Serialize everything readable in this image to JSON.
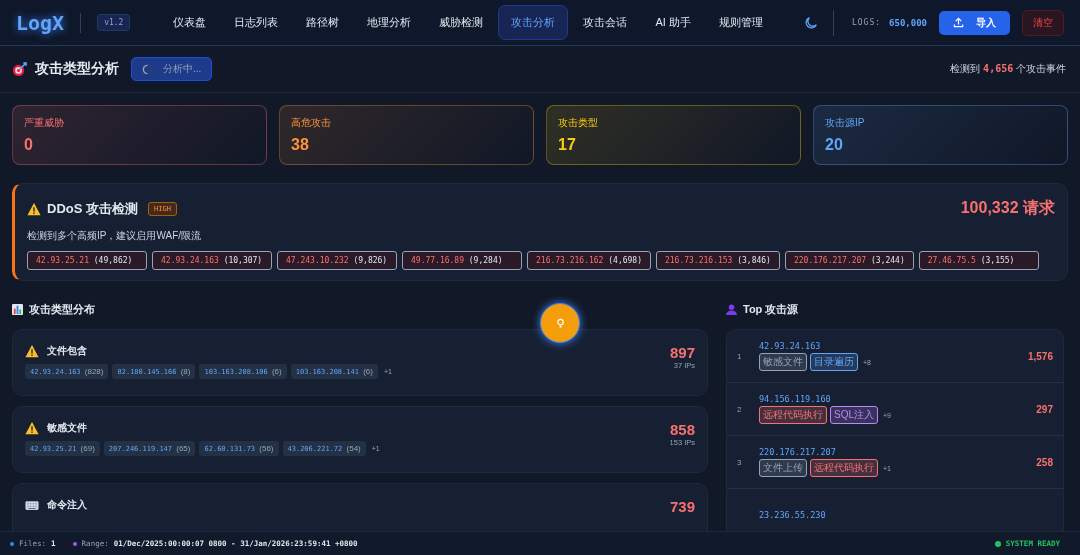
{
  "header": {
    "logo": "LogX",
    "version": "v1.2",
    "nav": [
      {
        "label": "仪表盘",
        "selected": false
      },
      {
        "label": "日志列表",
        "selected": false
      },
      {
        "label": "路径树",
        "selected": false
      },
      {
        "label": "地理分析",
        "selected": false
      },
      {
        "label": "威胁检测",
        "selected": false
      },
      {
        "label": "攻击分析",
        "selected": true
      },
      {
        "label": "攻击会话",
        "selected": false
      },
      {
        "label": "AI 助手",
        "selected": false
      },
      {
        "label": "规则管理",
        "selected": false
      }
    ],
    "logs_label": "LOGS:",
    "logs_value": "650,000",
    "import_button": "导入",
    "clear_button": "清空"
  },
  "page": {
    "title": "攻击类型分析",
    "status": "分析中...",
    "summary_prefix": "检测到",
    "summary_count": "4,656",
    "summary_suffix": "个攻击事件"
  },
  "stats": [
    {
      "label": "严重威胁",
      "value": "0",
      "color": "#f87171"
    },
    {
      "label": "高危攻击",
      "value": "38",
      "color": "#fb923c"
    },
    {
      "label": "攻击类型",
      "value": "17",
      "color": "#facc15"
    },
    {
      "label": "攻击源IP",
      "value": "20",
      "color": "#60a5fa"
    }
  ],
  "ddos": {
    "title": "DDoS 攻击检测",
    "badge": "HIGH",
    "requests": "100,332 请求",
    "advice": "检测到多个高频IP，建议启用WAF/限流",
    "ips": [
      {
        "ip": "42.93.25.21",
        "count": "(49,862)"
      },
      {
        "ip": "42.93.24.163",
        "count": "(10,307)"
      },
      {
        "ip": "47.243.10.232",
        "count": "(9,826)"
      },
      {
        "ip": "49.77.16.89",
        "count": "(9,284)"
      },
      {
        "ip": "216.73.216.162",
        "count": "(4,698)"
      },
      {
        "ip": "216.73.216.153",
        "count": "(3,846)"
      },
      {
        "ip": "220.176.217.207",
        "count": "(3,244)"
      },
      {
        "ip": "27.46.75.5",
        "count": "(3,155)"
      }
    ]
  },
  "distribution": {
    "title": "攻击类型分布",
    "items": [
      {
        "kind": "warning",
        "name": "文件包含",
        "total": "897",
        "ip_count": "37 IPs",
        "more": "+1",
        "ips": [
          {
            "ip": "42.93.24.163",
            "count": "(828)"
          },
          {
            "ip": "82.180.145.166",
            "count": "(8)"
          },
          {
            "ip": "103.163.208.106",
            "count": "(6)"
          },
          {
            "ip": "103.163.208.141",
            "count": "(6)"
          }
        ]
      },
      {
        "kind": "warning",
        "name": "敏感文件",
        "total": "858",
        "ip_count": "153 IPs",
        "more": "+1",
        "ips": [
          {
            "ip": "42.93.25.21",
            "count": "(69)"
          },
          {
            "ip": "207.246.119.147",
            "count": "(65)"
          },
          {
            "ip": "62.60.131.73",
            "count": "(56)"
          },
          {
            "ip": "43.206.221.72",
            "count": "(54)"
          }
        ]
      },
      {
        "kind": "keyboard",
        "name": "命令注入",
        "total": "739"
      }
    ]
  },
  "top_sources": {
    "title": "Top 攻击源",
    "rows": [
      {
        "rank": "1",
        "ip": "42.93.24.163",
        "total": "1,576",
        "more": "+8",
        "tags": [
          {
            "label": "敏感文件",
            "color": "#94a3b8"
          },
          {
            "label": "目录遍历",
            "color": "#60a5fa"
          }
        ]
      },
      {
        "rank": "2",
        "ip": "94.156.119.160",
        "total": "297",
        "more": "+9",
        "tags": [
          {
            "label": "远程代码执行",
            "color": "#f87171"
          },
          {
            "label": "SQL注入",
            "color": "#c084fc"
          }
        ]
      },
      {
        "rank": "3",
        "ip": "220.176.217.207",
        "total": "258",
        "more": "+1",
        "tags": [
          {
            "label": "文件上传",
            "color": "#94a3b8"
          },
          {
            "label": "远程代码执行",
            "color": "#f87171"
          }
        ]
      },
      {
        "ip": "23.236.55.230"
      }
    ]
  },
  "status_bar": {
    "files_label": "Files:",
    "files_value": "1",
    "range_label": "Range:",
    "range_value": "01/Dec/2025:00:00:07 0800 - 31/Jan/2026:23:59:41 +0800",
    "system": "SYSTEM READY"
  }
}
